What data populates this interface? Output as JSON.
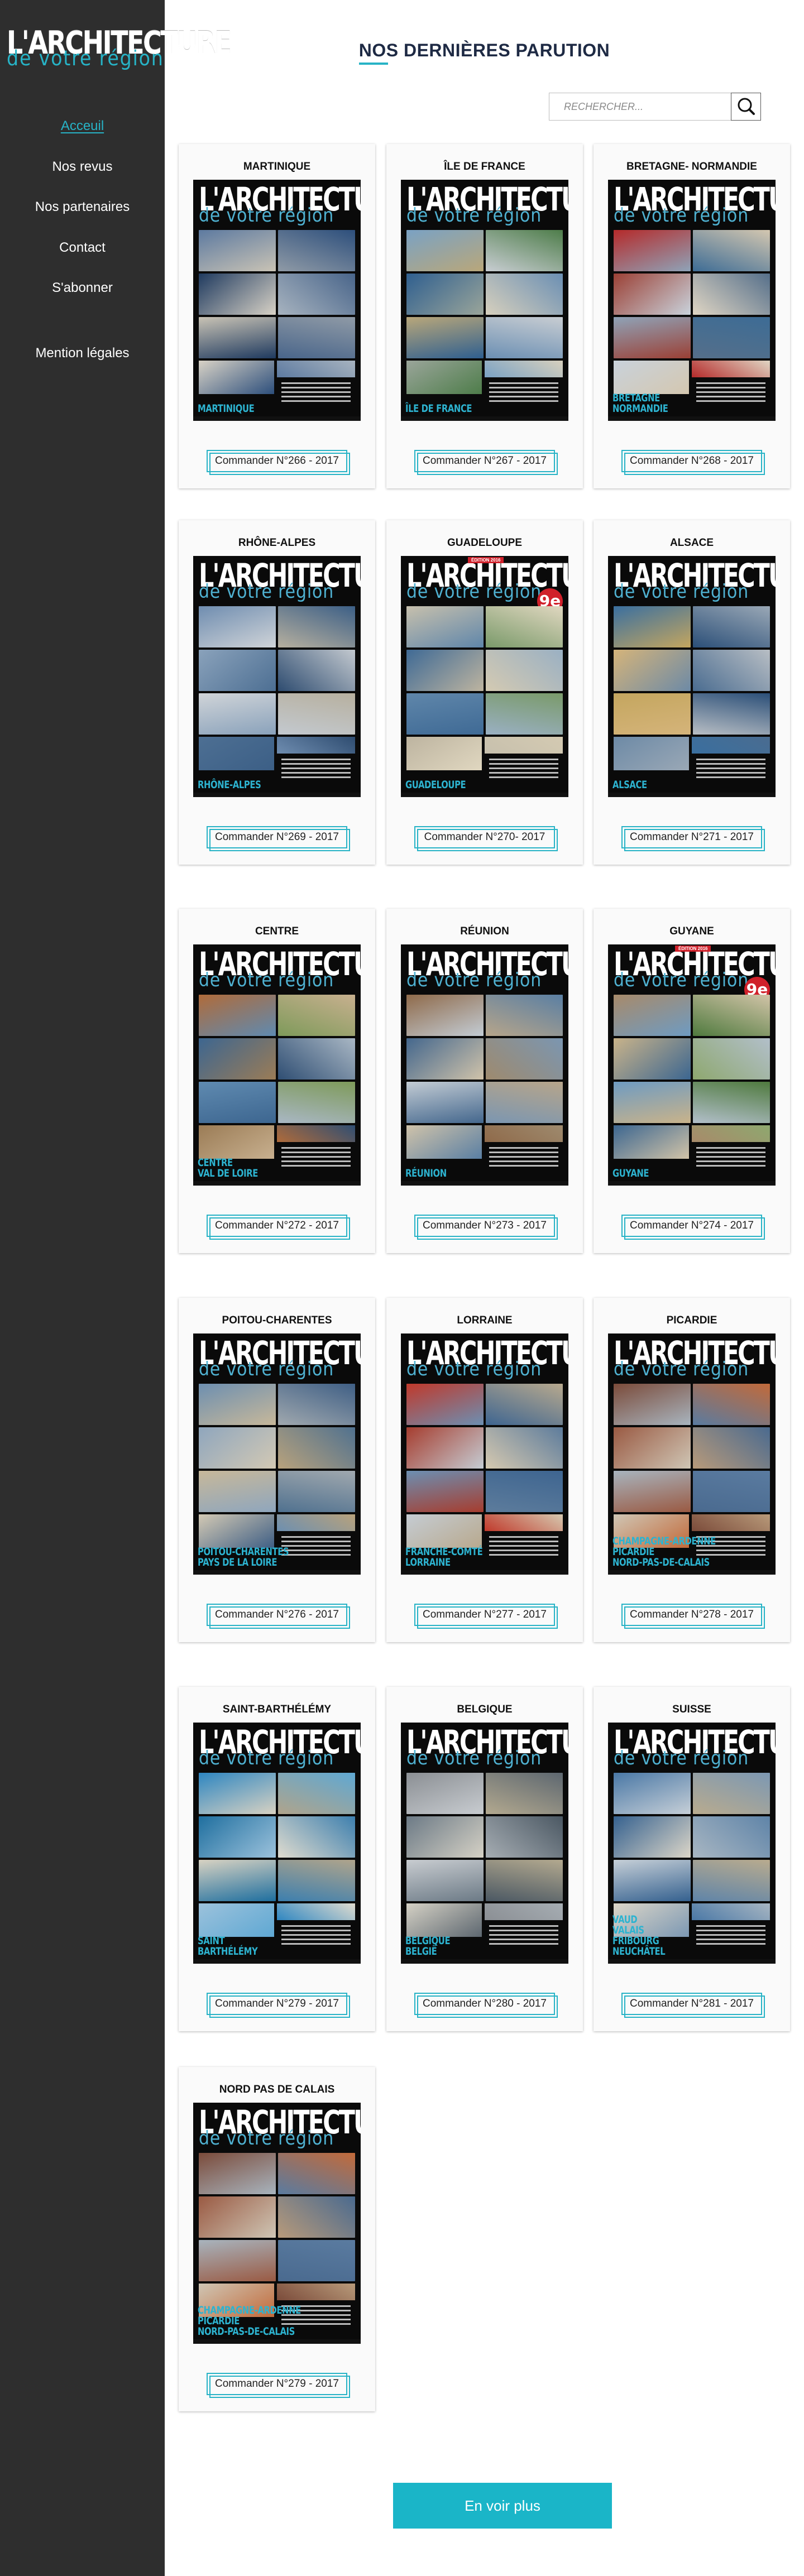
{
  "logo": {
    "line1": "L'ARCHITECTURE",
    "line2": "de votre région"
  },
  "nav": [
    {
      "label": "Acceuil",
      "active": true
    },
    {
      "label": "Nos revus"
    },
    {
      "label": "Nos partenaires"
    },
    {
      "label": "Contact"
    },
    {
      "label": "S'abonner"
    },
    {
      "label": "Mention légales"
    }
  ],
  "page_title": "NOS DERNIÈRES PARUTION",
  "search": {
    "placeholder": "RECHERCHER...",
    "icon": "search-icon"
  },
  "cover_brand": {
    "line1": "L'ARCHITECTURE",
    "line2": "de votre région"
  },
  "cards": [
    {
      "region": "MARTINIQUE",
      "cover_name": "MARTINIQUE",
      "button": "Commander N°266 - 2017"
    },
    {
      "region": "ÎLE DE FRANCE",
      "cover_name": "ÎLE DE FRANCE",
      "button": "Commander N°267 - 2017"
    },
    {
      "region": "BRETAGNE- NORMANDIE",
      "cover_name": "BRETAGNE\nNORMANDIE",
      "button": "Commander N°268 - 2017"
    },
    {
      "region": "RHÔNE-ALPES",
      "cover_name": "RHÔNE-ALPES",
      "button": "Commander N°269 - 2017"
    },
    {
      "region": "GUADELOUPE",
      "cover_name": "GUADELOUPE",
      "button": "Commander N°270- 2017",
      "badge": "9e",
      "edition": "ÉDITION 2016"
    },
    {
      "region": "ALSACE",
      "cover_name": "ALSACE",
      "button": "Commander N°271 - 2017"
    },
    {
      "region": "CENTRE",
      "cover_name": "CENTRE\nVAL DE LOIRE",
      "button": "Commander N°272 - 2017"
    },
    {
      "region": "RÉUNION",
      "cover_name": "RÉUNION",
      "button": "Commander N°273 - 2017"
    },
    {
      "region": "GUYANE",
      "cover_name": "GUYANE",
      "button": "Commander N°274 - 2017",
      "badge": "9e",
      "edition": "ÉDITION 2016"
    },
    {
      "region": "POITOU-CHARENTES",
      "cover_name": "POITOU-CHARENTES\nPAYS DE LA LOIRE",
      "button": "Commander N°276 - 2017"
    },
    {
      "region": "LORRAINE",
      "cover_name": "FRANCHE-COMTÉ\nLORRAINE",
      "button": "Commander N°277 - 2017"
    },
    {
      "region": "PICARDIE",
      "cover_name": "CHAMPAGNE-ARDENNE\nPICARDIE\nNORD-PAS-DE-CALAIS",
      "button": "Commander N°278 - 2017"
    },
    {
      "region": "SAINT-BARTHÉLÉMY",
      "cover_name": "SAINT\nBARTHÉLÉMY",
      "button": "Commander N°279 - 2017"
    },
    {
      "region": "BELGIQUE",
      "cover_name": "BELGIQUE\nBELGIË",
      "button": "Commander N°280 - 2017"
    },
    {
      "region": "SUISSE",
      "cover_name": "VAUD\nVALAIS\nFRIBOURG\nNEUCHÂTEL",
      "button": "Commander N°281 - 2017"
    },
    {
      "region": "NORD PAS DE CALAIS",
      "cover_name": "CHAMPAGNE-ARDENNE\nPICARDIE\nNORD-PAS-DE-CALAIS",
      "button": "Commander N°279 - 2017"
    }
  ],
  "more_button": "En voir plus",
  "colors": {
    "sidebar": "#2e2e2e",
    "accent": "#27b3c6",
    "button": "#1ab5c8",
    "title": "#1e2a44"
  }
}
